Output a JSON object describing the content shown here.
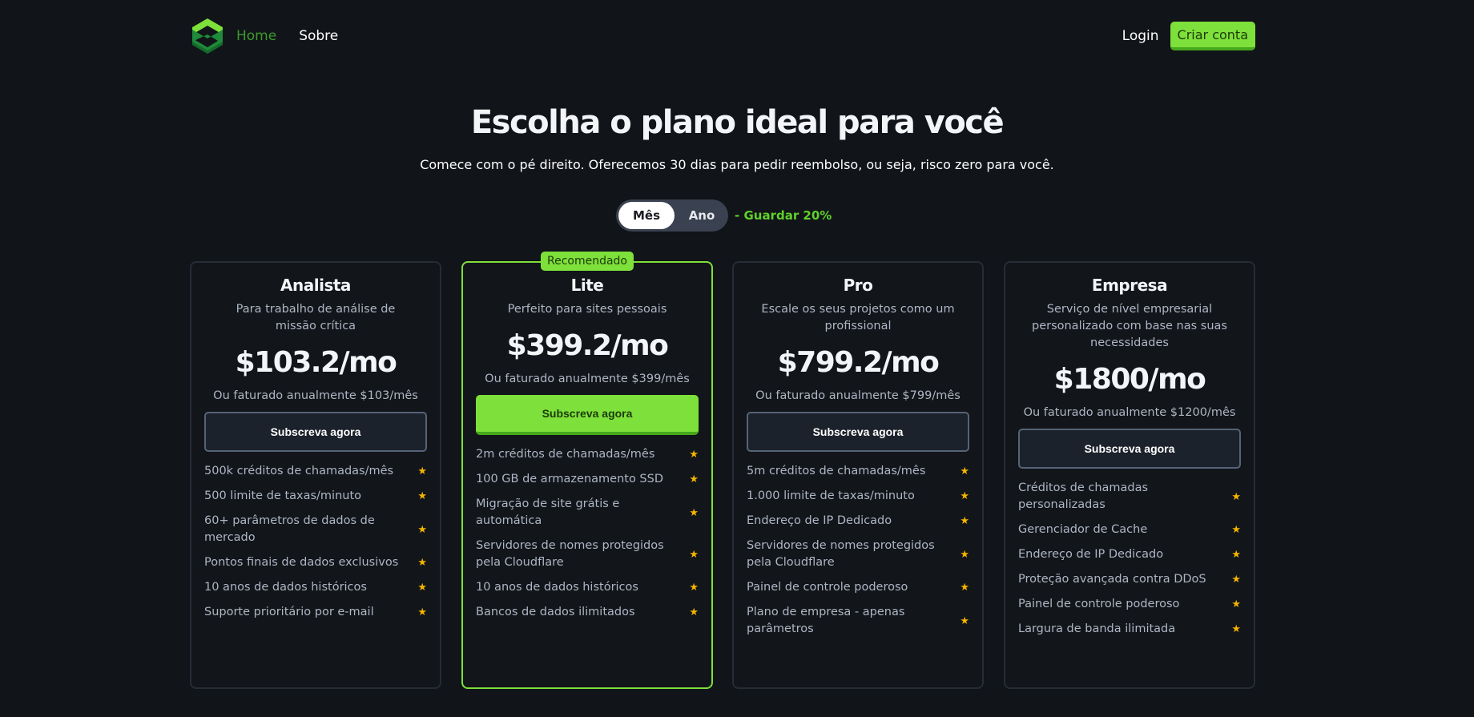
{
  "nav": {
    "home": "Home",
    "about": "Sobre",
    "login": "Login",
    "signup": "Criar conta"
  },
  "hero": {
    "title": "Escolha o plano ideal para você",
    "subtitle": "Comece com o pé direito. Oferecemos 30 dias para pedir reembolso, ou seja, risco zero para você."
  },
  "billing_toggle": {
    "monthly": "Mês",
    "yearly": "Ano",
    "selected": "Mês",
    "save_text": "- Guardar 20%"
  },
  "colors": {
    "accent": "#7ee03a",
    "background": "#111418",
    "star": "#f4b400"
  },
  "plans": [
    {
      "name": "Analista",
      "description": "Para trabalho de análise de missão crítica",
      "price": "$103.2/mo",
      "billed": "Ou faturado anualmente $103/mês",
      "button": "Subscreva agora",
      "features": [
        "500k créditos de chamadas/mês",
        "500 limite de taxas/minuto",
        "60+ parâmetros de dados de mercado",
        "Pontos finais de dados exclusivos",
        "10 anos de dados históricos",
        "Suporte prioritário por e-mail"
      ]
    },
    {
      "name": "Lite",
      "badge": "Recomendado",
      "description": "Perfeito para sites pessoais",
      "price": "$399.2/mo",
      "billed": "Ou faturado anualmente $399/mês",
      "button": "Subscreva agora",
      "features": [
        "2m créditos de chamadas/mês",
        "100 GB de armazenamento SSD",
        "Migração de site grátis e automática",
        "Servidores de nomes protegidos pela Cloudflare",
        "10 anos de dados históricos",
        "Bancos de dados ilimitados"
      ]
    },
    {
      "name": "Pro",
      "description": "Escale os seus projetos como um profissional",
      "price": "$799.2/mo",
      "billed": "Ou faturado anualmente $799/mês",
      "button": "Subscreva agora",
      "features": [
        "5m créditos de chamadas/mês",
        "1.000 limite de taxas/minuto",
        "Endereço de IP Dedicado",
        "Servidores de nomes protegidos pela Cloudflare",
        "Painel de controle poderoso",
        "Plano de empresa - apenas parâmetros"
      ]
    },
    {
      "name": "Empresa",
      "description": "Serviço de nível empresarial personalizado com base nas suas necessidades",
      "price": "$1800/mo",
      "billed": "Ou faturado anualmente $1200/mês",
      "button": "Subscreva agora",
      "features": [
        "Créditos de chamadas personalizadas",
        "Gerenciador de Cache",
        "Endereço de IP Dedicado",
        "Proteção avançada contra DDoS",
        "Painel de controle poderoso",
        "Largura de banda ilimitada"
      ]
    }
  ]
}
